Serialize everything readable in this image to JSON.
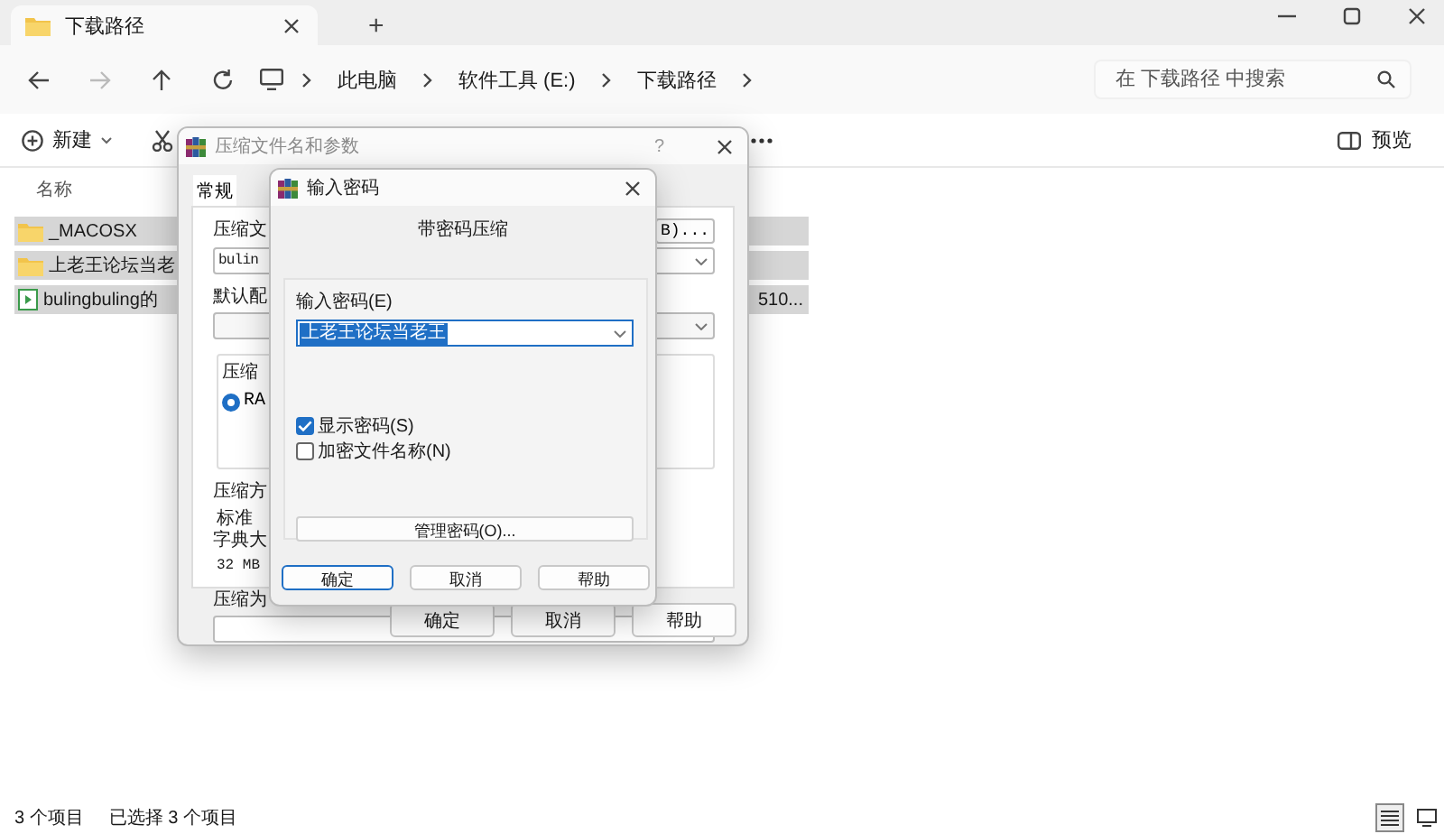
{
  "explorer": {
    "tabs": [
      {
        "label": "下载路径",
        "selected": true
      }
    ],
    "new_tab": "+",
    "breadcrumbs": [
      "此电脑",
      "软件工具 (E:)",
      "下载路径"
    ],
    "search": {
      "placeholder": "在 下载路径 中搜索"
    },
    "toolbar": {
      "new_label": "新建",
      "preview_label": "预览"
    },
    "columns": [
      "名称"
    ],
    "files": [
      {
        "name": "_MACOSX",
        "kind": "folder",
        "selected": true
      },
      {
        "name": "上老王论坛当老",
        "kind": "folder",
        "selected": true
      },
      {
        "name": "bulingbuling的",
        "kind": "video",
        "selected": true,
        "name_end": "510..."
      }
    ],
    "status": {
      "count": "3 个项目",
      "selection": "已选择 3 个项目"
    },
    "views": [
      {
        "kind": "details",
        "selected": true
      },
      {
        "kind": "tiles",
        "selected": false
      }
    ]
  },
  "archive_dialog": {
    "title": "压缩文件名和参数",
    "help": "?",
    "tabs": [
      {
        "label": "常规",
        "selected": true
      }
    ],
    "name_label": "压缩文",
    "browse_button": "B)...",
    "name_value": "bulin",
    "profile_label": "默认配",
    "format_group": "压缩",
    "formats": [
      {
        "label": "RA",
        "selected": true
      }
    ],
    "method_label": "压缩方",
    "method_value": "标准",
    "dict_label": "字典大",
    "dict_value": "32 MB",
    "split_label": "压缩为",
    "buttons": [
      {
        "label": "确定"
      },
      {
        "label": "取消"
      },
      {
        "label": "帮助"
      }
    ]
  },
  "password_dialog": {
    "title": "输入密码",
    "heading": "带密码压缩",
    "password_label": "输入密码(E)",
    "password_value": "上老王论坛当老王",
    "password_selected": true,
    "options": [
      {
        "label": "显示密码(S)",
        "checked": true
      },
      {
        "label": "加密文件名称(N)",
        "checked": false
      }
    ],
    "manage_button": "管理密码(O)...",
    "buttons": [
      {
        "label": "确定",
        "default": true
      },
      {
        "label": "取消",
        "default": false
      },
      {
        "label": "帮助",
        "default": false
      }
    ]
  }
}
